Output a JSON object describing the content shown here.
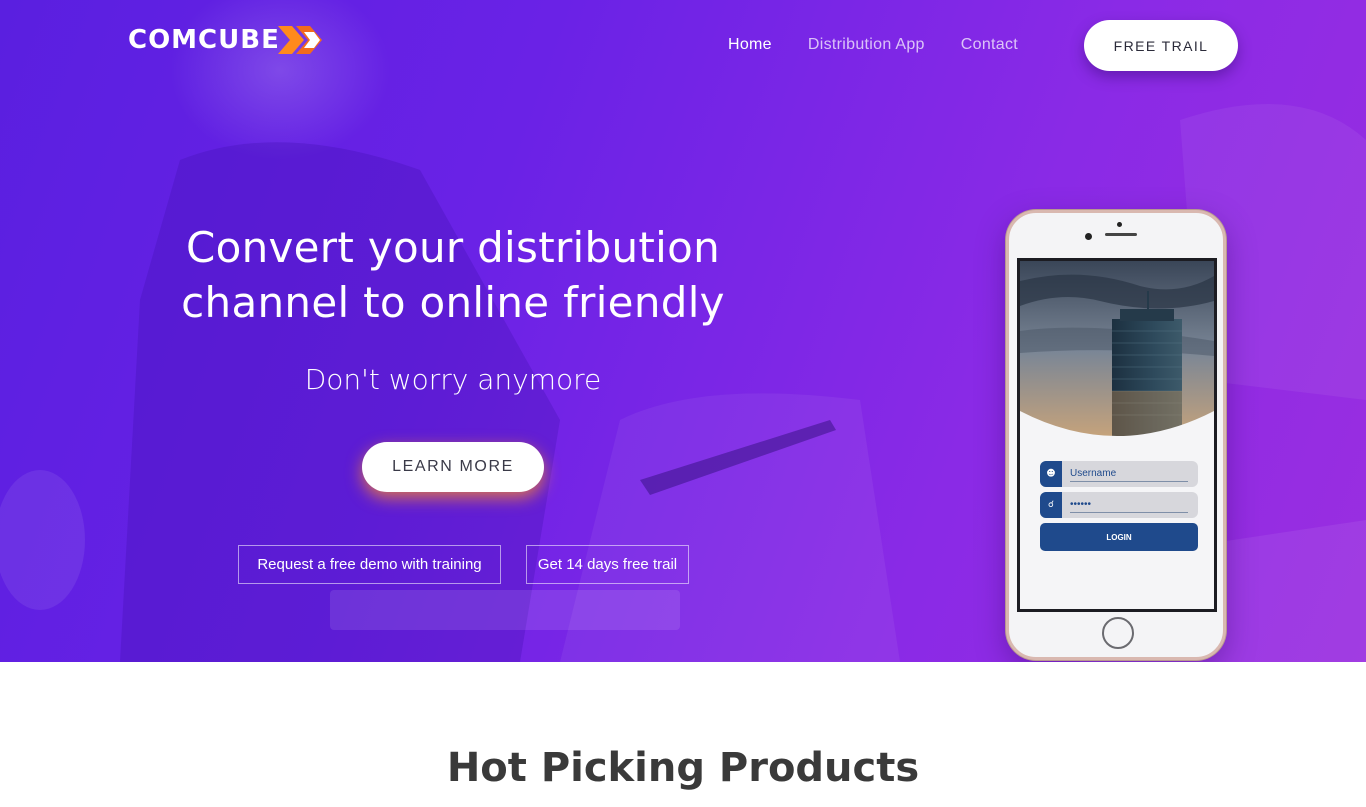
{
  "brand": {
    "logo_text": "COMCUBE",
    "logo_x": "X",
    "logo_x_colors": [
      "#ff8a1c",
      "#f26b1d"
    ]
  },
  "nav": {
    "items": [
      {
        "label": "Home",
        "active": true
      },
      {
        "label": "Distribution App",
        "active": false
      },
      {
        "label": "Contact",
        "active": false
      }
    ],
    "cta_label": "FREE TRAIL"
  },
  "hero": {
    "headline_line1": "Convert your distribution",
    "headline_line2": "channel to online friendly",
    "subline": "Don't worry anymore",
    "learn_more_label": "LEARN MORE",
    "demo_label": "Request a free demo with training",
    "trial_label": "Get 14 days free trail",
    "gradient_colors": [
      "#5a1fe0",
      "#9a2ee0"
    ]
  },
  "phone": {
    "username_placeholder": "Username",
    "password_value": "••••••",
    "login_label": "LOGIN",
    "user_icon": "user-icon",
    "lock_icon": "lock-icon",
    "accent_color": "#1f4a8c"
  },
  "section": {
    "title": "Hot Picking Products"
  }
}
